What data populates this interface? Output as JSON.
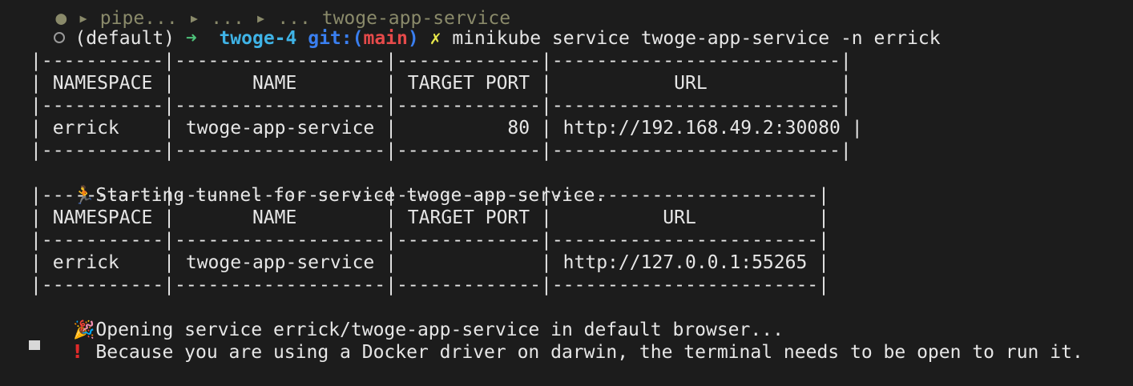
{
  "terminal": {
    "previous_line_fragment": "● ▸ pipe... ▸ ... ▸ ... twoge-app-service",
    "prompt": {
      "env": "(default)",
      "arrow": "➜",
      "directory": "twoge-4",
      "git_prefix": "git:(",
      "branch": "main",
      "git_suffix": ")",
      "dirty_marker": "✗",
      "command": "minikube service twoge-app-service -n errick"
    },
    "table1": {
      "border_top": "|-----------|-------------------|-------------|--------------------------|",
      "header": "| NAMESPACE |       NAME        | TARGET PORT |           URL            |",
      "border_mid": "|-----------|-------------------|-------------|--------------------------|",
      "row": "| errick    | twoge-app-service |          80 | http://192.168.49.2:30080 |",
      "border_bottom": "|-----------|-------------------|-------------|--------------------------|"
    },
    "tunnel_message": {
      "icon": "runner-icon",
      "text": "Starting tunnel for service twoge-app-service."
    },
    "table2": {
      "border_top": "|-----------|-------------------|-------------|------------------------|",
      "header": "| NAMESPACE |       NAME        | TARGET PORT |          URL           |",
      "border_mid": "|-----------|-------------------|-------------|------------------------|",
      "row": "| errick    | twoge-app-service |             | http://127.0.0.1:55265 |",
      "border_bottom": "|-----------|-------------------|-------------|------------------------|"
    },
    "opening_message": {
      "icon": "party-popper-icon",
      "text": "Opening service errick/twoge-app-service in default browser..."
    },
    "warning_message": {
      "icon": "exclamation-icon",
      "text": "Because you are using a Docker driver on darwin, the terminal needs to be open to run it."
    }
  }
}
